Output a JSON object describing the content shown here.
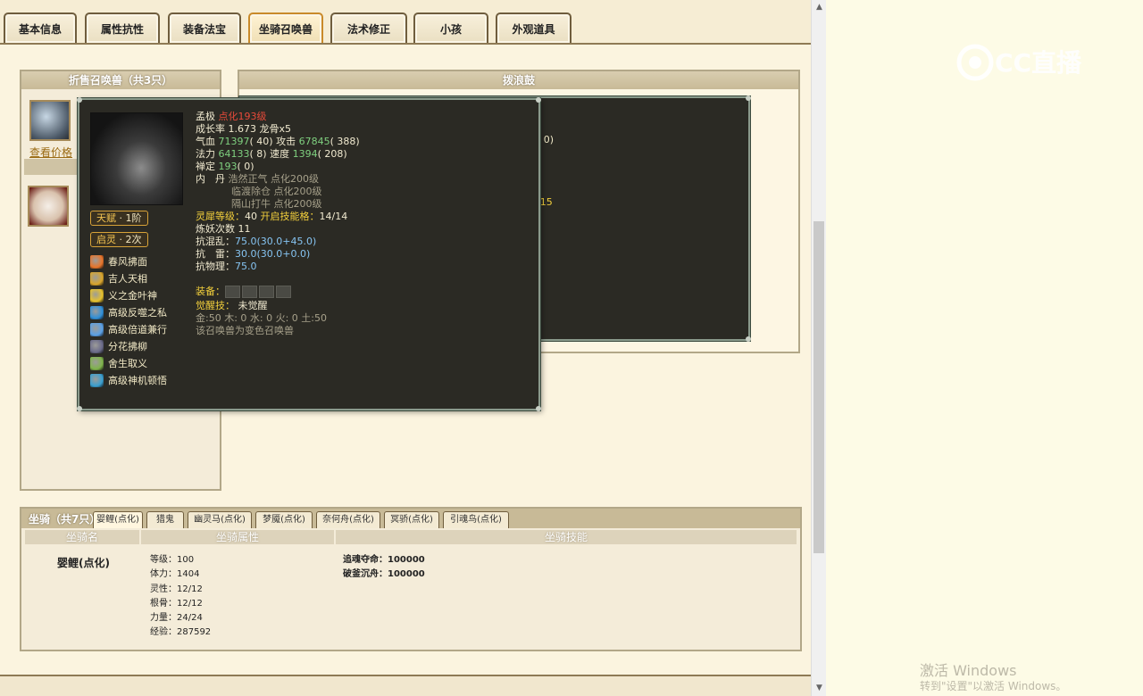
{
  "tabs": [
    {
      "label": "基本信息",
      "active": false
    },
    {
      "label": "属性抗性",
      "active": false
    },
    {
      "label": "装备法宝",
      "active": false
    },
    {
      "label": "坐骑召唤兽",
      "active": true
    },
    {
      "label": "法术修正",
      "active": false
    },
    {
      "label": "小孩",
      "active": false
    },
    {
      "label": "外观道具",
      "active": false
    }
  ],
  "left_panel": {
    "title": "折售召唤兽（共3只）",
    "view_price": "查看价格"
  },
  "right_panel": {
    "title": "拨浪鼓",
    "partial_values": [
      "2( 0)",
      "0)",
      "",
      "",
      "",
      "0/15",
      "",
      "",
      "",
      "",
      "",
      "",
      "0"
    ]
  },
  "pet_popup": {
    "badges": [
      {
        "label": "天赋",
        "value": "1阶"
      },
      {
        "label": "启灵",
        "value": "2次"
      }
    ],
    "skills": [
      {
        "name": "春风拂面",
        "icon": "fire-icon",
        "color": "#e7742a"
      },
      {
        "name": "吉人天相",
        "icon": "lucky-icon",
        "color": "#d9a52b"
      },
      {
        "name": "义之金叶神",
        "icon": "gold-leaf-icon",
        "color": "#e6c12c"
      },
      {
        "name": "高级反噬之私",
        "icon": "reverse-icon",
        "color": "#2f8fd8"
      },
      {
        "name": "高级倍道兼行",
        "icon": "speed-icon",
        "color": "#5aa0e6"
      },
      {
        "name": "分花拂柳",
        "icon": "flower-icon",
        "color": "#6b6b8a"
      },
      {
        "name": "舍生取义",
        "icon": "sacrifice-icon",
        "color": "#7fb34a"
      },
      {
        "name": "高级神机顿悟",
        "icon": "insight-icon",
        "color": "#3a9fd0"
      }
    ],
    "name": "孟极",
    "level": "点化193级",
    "growth": "成长率 1.673 龙骨x5",
    "hp_label": "气血",
    "hp_value": "71397",
    "hp_extra": "( 40)",
    "atk_label": "攻击",
    "atk_value": "67845",
    "atk_extra": "( 388)",
    "mp_label": "法力",
    "mp_value": "64133",
    "mp_extra": "( 8)",
    "spd_label": "速度",
    "spd_value": "1394",
    "spd_extra": "( 208)",
    "ding_label": "禅定",
    "ding_value": "193",
    "ding_extra": "( 0)",
    "neidan_label": "内　丹",
    "neidan": [
      "浩然正气 点化200级",
      "临渡除仓 点化200级",
      "隔山打牛 点化200级"
    ],
    "lingxi_label": "灵犀等级：",
    "lingxi_value": "40",
    "skillcap_label": "开启技能格：",
    "skillcap_value": "14/14",
    "lianyao": "炼妖次数 11",
    "res_hunluan_label": "抗混乱：",
    "res_hunluan_value": "75.0(30.0+45.0)",
    "res_lei_label": "抗　雷：",
    "res_lei_value": "30.0(30.0+0.0)",
    "res_wuli_label": "抗物理：",
    "res_wuli_value": "75.0",
    "equip_label": "装备：",
    "awaken_label": "觉醒技：",
    "awaken_value": "未觉醒",
    "elements": "金:50 木: 0 水: 0 火: 0 土:50",
    "variant_note": "该召唤兽为变色召唤兽"
  },
  "mount_panel": {
    "title": "坐骑（共7只）",
    "tabs": [
      "婴鲤(点化)",
      "猎鬼",
      "幽灵马(点化)",
      "梦魇(点化)",
      "奈何舟(点化)",
      "冥骄(点化)",
      "引魂鸟(点化)"
    ],
    "columns": [
      "坐骑名",
      "坐骑属性",
      "坐骑技能"
    ],
    "name": "婴鲤(点化)",
    "attrs": [
      "等级：100",
      "体力：1404",
      "灵性：12/12",
      "根骨：12/12",
      "力量：24/24",
      "经验：287592"
    ],
    "skills": [
      "追魂夺命：100000",
      "破釜沉舟：100000"
    ]
  },
  "watermark": {
    "title": "激活 Windows",
    "subtitle": "转到\"设置\"以激活 Windows。"
  },
  "logo": {
    "text": "CC直播"
  }
}
